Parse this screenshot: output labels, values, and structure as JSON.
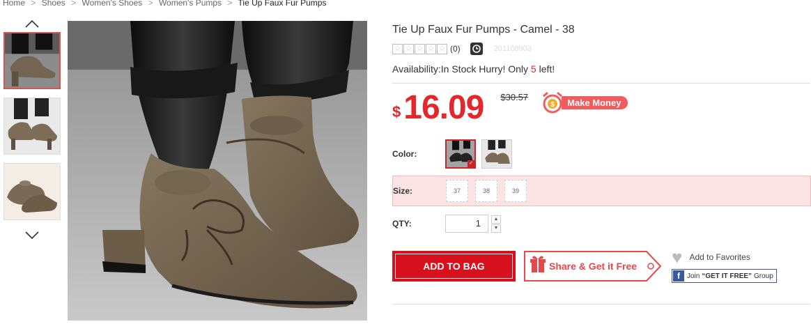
{
  "breadcrumb": {
    "items": [
      "Home",
      "Shoes",
      "Women's Shoes",
      "Women's Pumps"
    ],
    "current": "Tie Up Faux Fur Pumps",
    "separator": ">"
  },
  "gallery": {
    "up_icon": "chevron-up-icon",
    "down_icon": "chevron-down-icon",
    "thumbnail_count": 3
  },
  "product": {
    "title": "Tie Up Faux Fur Pumps - Camel - 38",
    "rating_count": "(0)",
    "sku": "201108903",
    "availability_prefix": "Availability:In Stock Hurry! Only ",
    "stock_left": "5",
    "availability_suffix": " left!",
    "currency_symbol": "$",
    "price": "16.09",
    "old_price": "$30.57",
    "make_money_label": "Make Money"
  },
  "options": {
    "color_label": "Color:",
    "size_label": "Size:",
    "sizes": [
      "37",
      "38",
      "39"
    ],
    "qty_label": "QTY:",
    "qty_value": "1"
  },
  "actions": {
    "add_to_bag": "ADD TO BAG",
    "share": "Share & Get it Free",
    "favorites": "Add to Favorites",
    "fb_join": "Join",
    "fb_group_name": "“GET IT FREE”",
    "fb_group_suffix": "Group"
  },
  "colors": {
    "accent_red": "#e4262d",
    "button_red": "#d8101e",
    "size_highlight": "#fde4e4",
    "share_red": "#e8474c",
    "facebook_blue": "#3b5998"
  }
}
